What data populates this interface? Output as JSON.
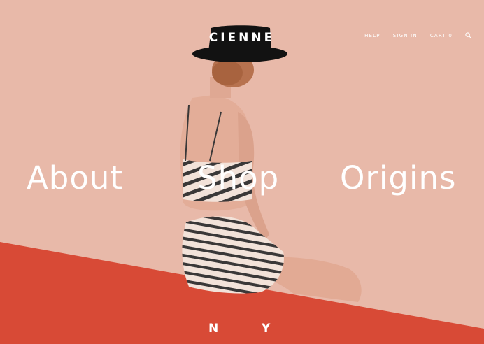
{
  "brand": {
    "logo": "CIENNE"
  },
  "header": {
    "links": [
      {
        "id": "help",
        "label": "HELP"
      },
      {
        "id": "signin",
        "label": "SIGN IN"
      },
      {
        "id": "cart",
        "label": "CART 0"
      }
    ],
    "search_icon": "search-icon"
  },
  "main_nav": {
    "about": "About",
    "shop": "Shop",
    "origins": "Origins"
  },
  "footer": {
    "left": "N",
    "right": "Y"
  },
  "colors": {
    "background": "#e8b9a9",
    "floor": "#d84a36",
    "text": "#ffffff"
  }
}
